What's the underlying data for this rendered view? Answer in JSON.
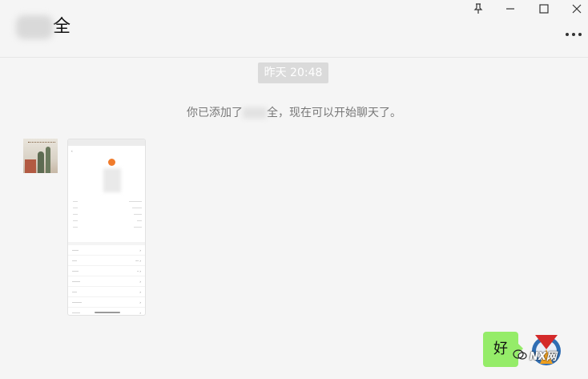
{
  "header": {
    "title_suffix": "全"
  },
  "window_controls": [
    {
      "name": "pin-icon"
    },
    {
      "name": "minimize-icon"
    },
    {
      "name": "maximize-icon"
    },
    {
      "name": "close-icon"
    }
  ],
  "chat": {
    "timestamp": "昨天 20:48",
    "system_message_prefix": "你已添加了",
    "system_message_suffix": "全，现在可以开始聊天了。",
    "my_message": "好",
    "watermark": "NX网"
  },
  "colors": {
    "bubble_green": "#95ec69",
    "timestamp_bg": "#dadada",
    "background": "#f5f5f5"
  }
}
